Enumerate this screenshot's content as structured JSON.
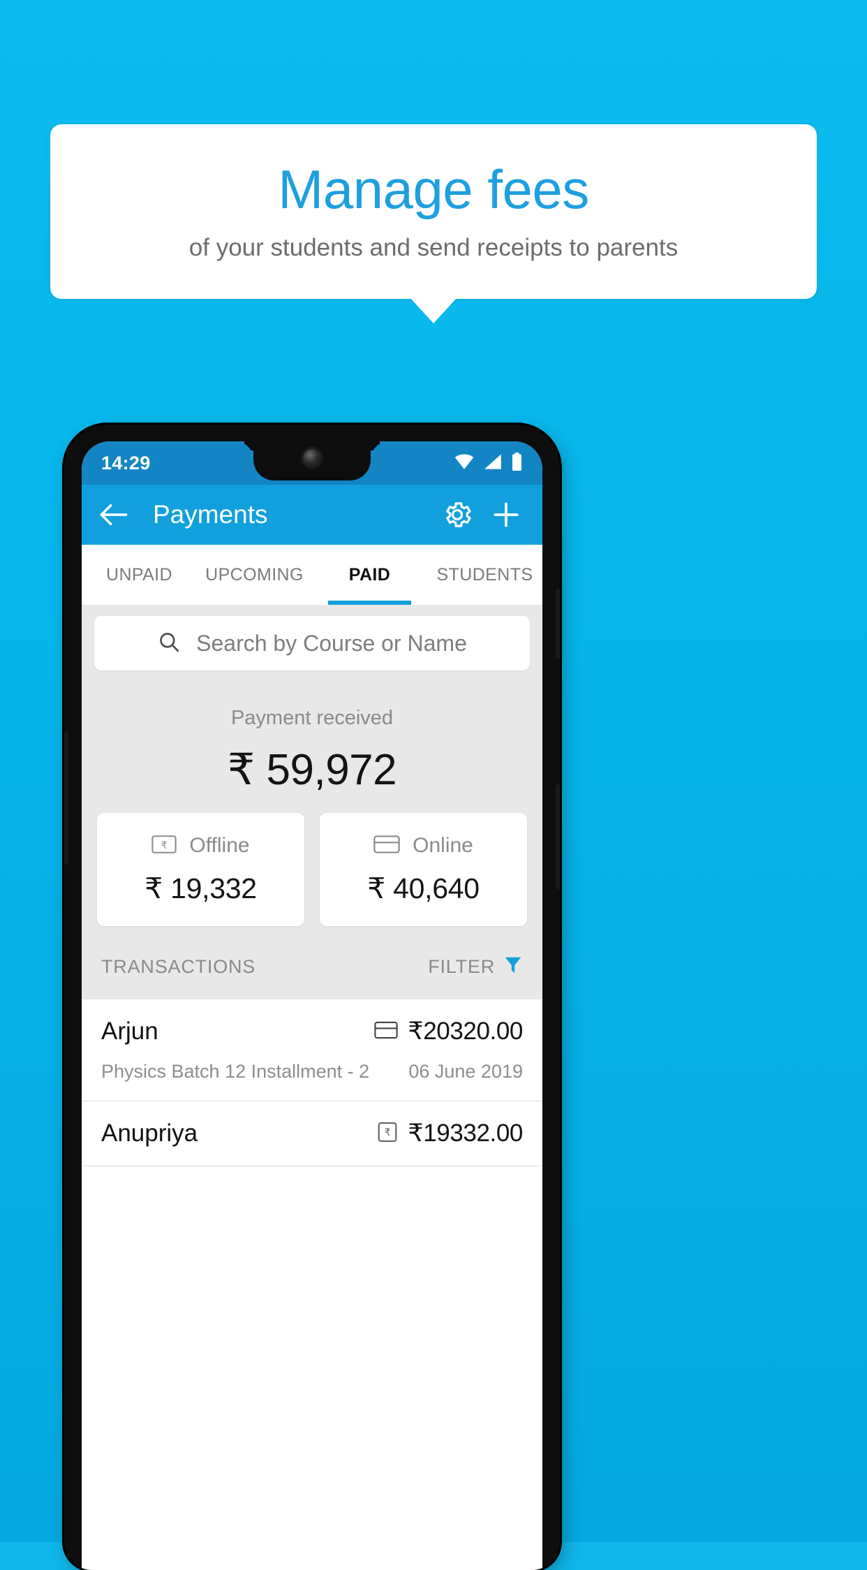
{
  "promo": {
    "title": "Manage fees",
    "subtitle": "of your students and send receipts to parents",
    "background_color": "#0cbcef",
    "title_color": "#1d9fe0"
  },
  "phone": {
    "status_bar": {
      "time": "14:29",
      "icons": [
        "wifi-icon",
        "cellular-signal-icon",
        "battery-icon"
      ],
      "background_color": "#1385c4"
    },
    "app_bar": {
      "back_icon": "back-arrow-icon",
      "title": "Payments",
      "settings_icon": "gear-icon",
      "add_icon": "plus-icon",
      "background_color": "#11a0dd"
    },
    "tabs": [
      {
        "label": "UNPAID",
        "active": false
      },
      {
        "label": "UPCOMING",
        "active": false
      },
      {
        "label": "PAID",
        "active": true
      },
      {
        "label": "STUDENTS",
        "active": false
      }
    ],
    "search": {
      "icon": "search-icon",
      "placeholder": "Search by Course or Name",
      "value": ""
    },
    "summary": {
      "label": "Payment received",
      "amount": "₹ 59,972"
    },
    "method_cards": [
      {
        "icon": "banknote-rupee-icon",
        "label": "Offline",
        "amount": "₹ 19,332"
      },
      {
        "icon": "credit-card-icon",
        "label": "Online",
        "amount": "₹ 40,640"
      }
    ],
    "transactions_header": {
      "title": "TRANSACTIONS",
      "filter_label": "FILTER",
      "filter_icon": "funnel-icon",
      "filter_icon_color": "#11a0dd"
    },
    "transactions": [
      {
        "name": "Arjun",
        "method_icon": "credit-card-icon",
        "amount": "₹20320.00",
        "course": "Physics Batch 12 Installment - 2",
        "date": "06 June 2019"
      },
      {
        "name": "Anupriya",
        "method_icon": "banknote-rupee-icon",
        "amount": "₹19332.00",
        "course": "",
        "date": ""
      }
    ]
  }
}
